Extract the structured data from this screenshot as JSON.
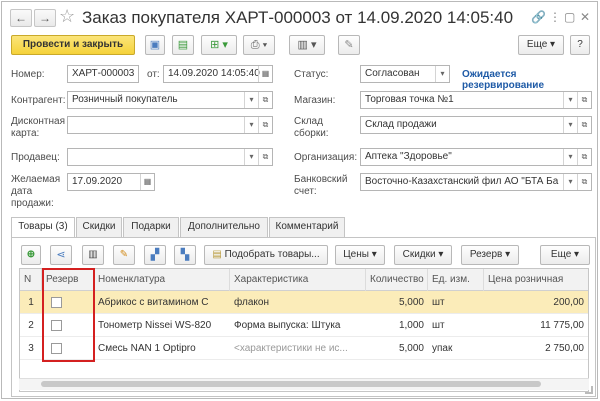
{
  "window": {
    "title": "Заказ покупателя ХАРТ-000003 от 14.09.2020 14:05:40"
  },
  "toolbar": {
    "post_close_label": "Провести и закрыть",
    "more_label": "Еще",
    "more_arrow": "▾",
    "help_label": "?"
  },
  "form": {
    "number_label": "Номер:",
    "number_value": "ХАРТ-000003",
    "date_label": "от:",
    "date_value": "14.09.2020 14:05:40",
    "status_label": "Статус:",
    "status_value": "Согласован",
    "status_link": "Ожидается резервирование",
    "counterparty_label": "Контрагент:",
    "counterparty_value": "Розничный покупатель",
    "store_label": "Магазин:",
    "store_value": "Торговая точка №1",
    "discount_card_label": "Дисконтная карта:",
    "discount_card_value": "",
    "warehouse_label": "Склад сборки:",
    "warehouse_value": "Склад продажи",
    "seller_label": "Продавец:",
    "seller_value": "",
    "org_label": "Организация:",
    "org_value": "Аптека \"Здоровье\"",
    "desired_date_label": "Желаемая дата продажи:",
    "desired_date_value": "17.09.2020",
    "bank_label": "Банковский счет:",
    "bank_value": "Восточно-Казахстанский фил АО \"БТА Ба"
  },
  "tabs": [
    {
      "label": "Товары (3)"
    },
    {
      "label": "Скидки"
    },
    {
      "label": "Подарки"
    },
    {
      "label": "Дополнительно"
    },
    {
      "label": "Комментарий"
    }
  ],
  "table_toolbar": {
    "pick_goods": "Подобрать товары...",
    "prices": "Цены",
    "discounts": "Скидки",
    "reserve": "Резерв",
    "more": "Еще"
  },
  "table": {
    "columns": [
      "N",
      "Резерв",
      "Номенклатура",
      "Характеристика",
      "Количество",
      "Ед. изм.",
      "Цена розничная"
    ],
    "rows": [
      {
        "n": "1",
        "reserve": false,
        "item": "Абрикос с витамином С",
        "characteristic": "флакон",
        "qty": "5,000",
        "unit": "шт",
        "price": "200,00"
      },
      {
        "n": "2",
        "reserve": false,
        "item": "Тонометр Nissei WS-820",
        "characteristic": "Форма выпуска: Штука",
        "qty": "1,000",
        "unit": "шт",
        "price": "11 775,00"
      },
      {
        "n": "3",
        "reserve": false,
        "item": "Смесь NAN 1 Optipro",
        "characteristic": "<характеристики не ис...",
        "qty": "5,000",
        "unit": "упак",
        "price": "2 750,00"
      }
    ]
  },
  "colors": {
    "accent_yellow": "#f5d23a",
    "selected_row": "#fbecb9",
    "highlight_red": "#d42020",
    "link_blue": "#1e5aa6"
  }
}
